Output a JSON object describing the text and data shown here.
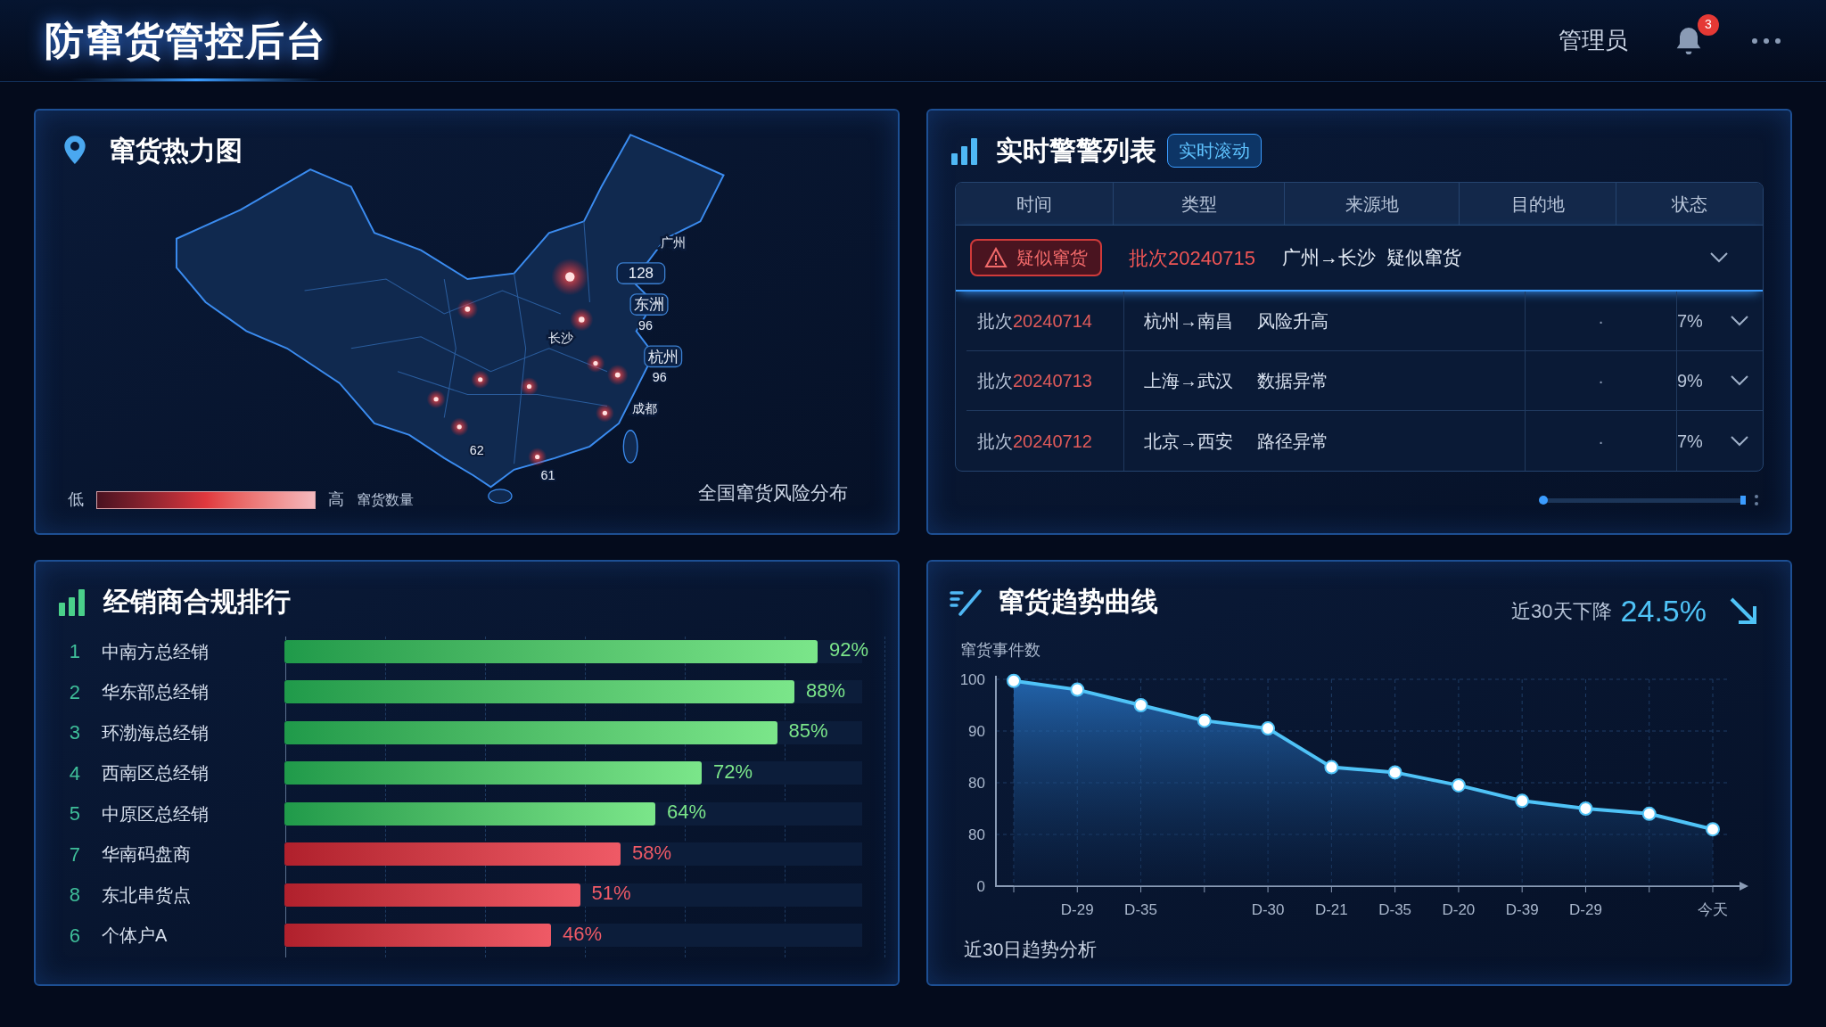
{
  "header": {
    "title": "防窜货管控后台",
    "user": "管理员",
    "notification_count": "3"
  },
  "heatmap": {
    "title": "窜货热力图",
    "labels": [
      {
        "text": "广州",
        "kind": "name"
      },
      {
        "text": "128",
        "kind": "boxed"
      },
      {
        "text": "东洲",
        "kind": "boxed"
      },
      {
        "text": "96",
        "kind": "plain"
      },
      {
        "text": "长沙",
        "kind": "name"
      },
      {
        "text": "杭州",
        "kind": "boxed"
      },
      {
        "text": "96",
        "kind": "plain"
      },
      {
        "text": "成都",
        "kind": "name"
      },
      {
        "text": "62",
        "kind": "plain"
      },
      {
        "text": "61",
        "kind": "plain"
      }
    ],
    "legend": {
      "low": "低",
      "high": "高",
      "caption": "窜货数量"
    },
    "footer": "全国窜货风险分布"
  },
  "alerts": {
    "title": "实时警警列表",
    "tag": "实时滚动",
    "columns": [
      "时间",
      "类型",
      "来源地",
      "目的地",
      "状态"
    ],
    "highlight": {
      "badge": "疑似窜货",
      "batch": "批次20240715",
      "route": "广州→长沙",
      "type": "疑似窜货"
    },
    "rows": [
      {
        "batch_label": "批次",
        "batch_no": "20240714",
        "route": "杭州→南昌",
        "type": "风险升高",
        "destination": "·",
        "rate": "7%"
      },
      {
        "batch_label": "批次",
        "batch_no": "20240713",
        "route": "上海→武汉",
        "type": "数据异常",
        "destination": "·",
        "rate": "9%"
      },
      {
        "batch_label": "批次",
        "batch_no": "20240712",
        "route": "北京→西安",
        "type": "路径异常",
        "destination": "·",
        "rate": "7%"
      }
    ]
  },
  "ranking": {
    "title": "经销商合规排行",
    "items": [
      {
        "rank": "1",
        "name": "中南方总经销",
        "value": "92%",
        "level": 0.92,
        "kind": "pass"
      },
      {
        "rank": "2",
        "name": "华东部总经销",
        "value": "88%",
        "level": 0.88,
        "kind": "pass"
      },
      {
        "rank": "3",
        "name": "环渤海总经销",
        "value": "85%",
        "level": 0.85,
        "kind": "pass"
      },
      {
        "rank": "4",
        "name": "西南区总经销",
        "value": "72%",
        "level": 0.72,
        "kind": "pass"
      },
      {
        "rank": "5",
        "name": "中原区总经销",
        "value": "64%",
        "level": 0.64,
        "kind": "pass"
      },
      {
        "rank": "7",
        "name": "华南码盘商",
        "value": "58%",
        "level": 0.58,
        "kind": "fail"
      },
      {
        "rank": "8",
        "name": "东北串货点",
        "value": "51%",
        "level": 0.51,
        "kind": "fail"
      },
      {
        "rank": "6",
        "name": "个体户A",
        "value": "46%",
        "level": 0.46,
        "kind": "fail"
      }
    ]
  },
  "trend": {
    "title": "窜货趋势曲线",
    "summary_label": "近30天下降",
    "summary_value": "24.5%",
    "footer": "近30日趋势分析",
    "chart_data": {
      "type": "area",
      "ylabel": "窜货事件数",
      "categories": [
        null,
        "D-29",
        "D-35",
        null,
        "D-30",
        "D-21",
        "D-35",
        "D-20",
        "D-39",
        "D-29",
        null,
        "今天"
      ],
      "series": [
        {
          "color": "#4fc3f7",
          "values": [
            99.7,
            98,
            95,
            92,
            90.5,
            83,
            82,
            79.5,
            76.5,
            75,
            74,
            71
          ]
        }
      ],
      "ylim": [
        60,
        100
      ],
      "grid": true,
      "yticks": [
        100,
        90,
        80
      ]
    },
    "lower_axis_labels": [
      "80",
      "0"
    ]
  }
}
